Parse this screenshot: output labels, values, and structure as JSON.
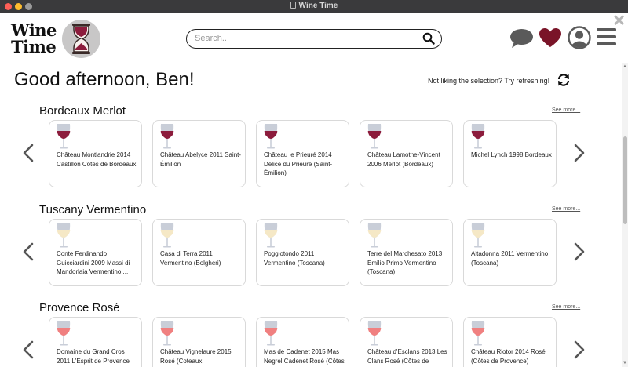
{
  "window": {
    "title": "Wine Time"
  },
  "header": {
    "logo_line1": "Wine",
    "logo_line2": "Time",
    "search_placeholder": "Search..",
    "icons": [
      "chat-icon",
      "heart-icon",
      "user-icon",
      "menu-icon",
      "search-icon",
      "close-icon"
    ]
  },
  "greeting": "Good afternoon, Ben!",
  "refresh_prompt": "Not liking the selection? Try refreshing!",
  "see_more": "See more...",
  "colors": {
    "red_wine": "#8c1c3c",
    "white_wine": "#f5e8c6",
    "rose_wine": "#f08080",
    "heart": "#7a1428",
    "icon_gray": "#5a5a5a",
    "glass": "#c9ced8"
  },
  "sections": [
    {
      "title": "Bordeaux Merlot",
      "wine_type": "red",
      "wines": [
        "Château Montlandrie 2014 Castillon Côtes de Bordeaux",
        "Château Abelyce 2011 Saint-Émilion",
        "Château le Prieuré 2014 Délice du Prieuré (Saint-Émilion)",
        "Château Lamothe-Vincent 2006 Merlot  (Bordeaux)",
        "Michel Lynch 1998 Bordeaux"
      ]
    },
    {
      "title": "Tuscany Vermentino",
      "wine_type": "white",
      "wines": [
        "Conte Ferdinando Guicciardini 2009 Massi di Mandorlaia Vermentino ...",
        "Casa di Terra 2011 Vermentino (Bolgheri)",
        "Poggiotondo 2011 Vermentino (Toscana)",
        "Terre del Marchesato 2013 Emilio Primo Vermentino (Toscana)",
        "Altadonna 2011 Vermentino (Toscana)"
      ]
    },
    {
      "title": "Provence Rosé",
      "wine_type": "rose",
      "wines": [
        "Domaine du Grand Cros 2011 L'Esprit de Provence",
        "Château Vignelaure 2015 Rosé (Coteaux",
        "Mas de Cadenet 2015 Mas Negrel Cadenet Rosé (Côtes",
        "Château d'Esclans 2013 Les Clans Rosé (Côtes de",
        "Château Riotor 2014 Rosé (Côtes de Provence)"
      ]
    }
  ]
}
